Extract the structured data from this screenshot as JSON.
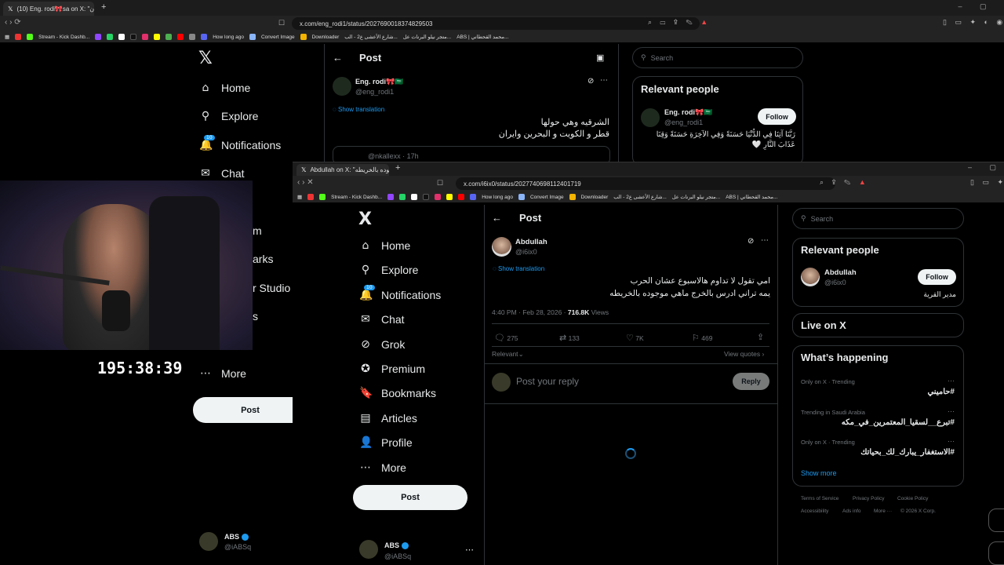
{
  "back_window": {
    "tab_title": "(10) Eng. rodi🎀sa on X: \"وايران",
    "url": "x.com/eng_rodi1/status/2027690018374829503",
    "nav": [
      "Home",
      "Explore",
      "Notifications",
      "Chat"
    ],
    "nav_partial": [
      "m",
      "arks",
      "r Studio",
      "s"
    ],
    "notification_count": "10",
    "more_label": "More",
    "post_button": "Post",
    "header_title": "Post",
    "author_name": "Eng. rodi🎀🇸🇦",
    "author_handle": "@eng_rodi1",
    "show_translation": "Show translation",
    "tweet_line1": "الشرقيه وهي حولها",
    "tweet_line2": "قطر و الكويت و البحرين وايران",
    "quote_handle": "@nkallexx · 17h",
    "search_placeholder": "Search",
    "relevant_title": "Relevant people",
    "rp_name": "Eng. rodi🎀🇸🇦",
    "rp_handle": "@eng_rodi1",
    "rp_follow": "Follow",
    "rp_bio_1": "رَبَّنَا آتِنَا فِي الدُّنْيَا حَسَنَةً وَفِي الآخِرَةِ حَسَنَةً وَقِنَا",
    "rp_bio_2": "عَذَابَ النَّارِ 🤍",
    "account_name": "ABS",
    "account_handle": "@iABSq"
  },
  "stream": {
    "timer": "195:38:39"
  },
  "bookmarks": [
    "Stream - Kick Dashb...",
    "How long ago",
    "Convert Image",
    "Downloader",
    "شارع الأعشى ع2 - الب...",
    "متجر نيلو البرنات عل...",
    "ABS | محمد القحطاني..."
  ],
  "front_window": {
    "tab_title": "Abdullah on X: \"موجوده بالخريطه",
    "url": "x.com/i6ix0/status/2027740698112401719",
    "logo": "X",
    "nav": [
      {
        "label": "Home",
        "icon": "⌂"
      },
      {
        "label": "Explore",
        "icon": "⚲"
      },
      {
        "label": "Notifications",
        "icon": "🔔"
      },
      {
        "label": "Chat",
        "icon": "✉"
      },
      {
        "label": "Grok",
        "icon": "⊘"
      },
      {
        "label": "Premium",
        "icon": "✪"
      },
      {
        "label": "Bookmarks",
        "icon": "🔖"
      },
      {
        "label": "Articles",
        "icon": "▤"
      },
      {
        "label": "Profile",
        "icon": "👤"
      },
      {
        "label": "More",
        "icon": "⋯"
      }
    ],
    "notification_count": "10",
    "post_button": "Post",
    "account_name": "ABS",
    "account_handle": "@iABSq",
    "header_title": "Post",
    "author_name": "Abdullah",
    "author_handle": "@i6ix0",
    "show_translation": "Show translation",
    "tweet_line1": "امي تقول لا تداوم هالاسبوع عشان الحرب",
    "tweet_line2": "يمه تراني ادرس بالخرج ماهي موجوده بالخريطه",
    "timestamp": "4:40 PM · Feb 28, 2026 · ",
    "views_count": "716.8K",
    "views_label": " Views",
    "replies": "275",
    "reposts": "133",
    "likes": "7K",
    "bookmarks": "469",
    "sort_label": "Relevant",
    "view_quotes": "View quotes",
    "reply_placeholder": "Post your reply",
    "reply_button": "Reply",
    "search_placeholder": "Search",
    "relevant_title": "Relevant people",
    "rp_name": "Abdullah",
    "rp_handle": "@i6ix0",
    "rp_follow": "Follow",
    "rp_bio": "مدير القرية",
    "live_title": "Live on X",
    "happening_title": "What’s happening",
    "trends": [
      {
        "context": "Only on X · Trending",
        "name": "#حاميني"
      },
      {
        "context": "Trending in Saudi Arabia",
        "name": "#تبرع__لسقيا_المعتمرين_في_مكه"
      },
      {
        "context": "Only on X · Trending",
        "name": "#الاستغفار_يبارك_لك_بحياتك"
      }
    ],
    "show_more": "Show more",
    "footer": [
      "Terms of Service",
      "Privacy Policy",
      "Cookie Policy",
      "Accessibility",
      "Ads info",
      "More ···",
      "© 2026 X Corp."
    ]
  }
}
